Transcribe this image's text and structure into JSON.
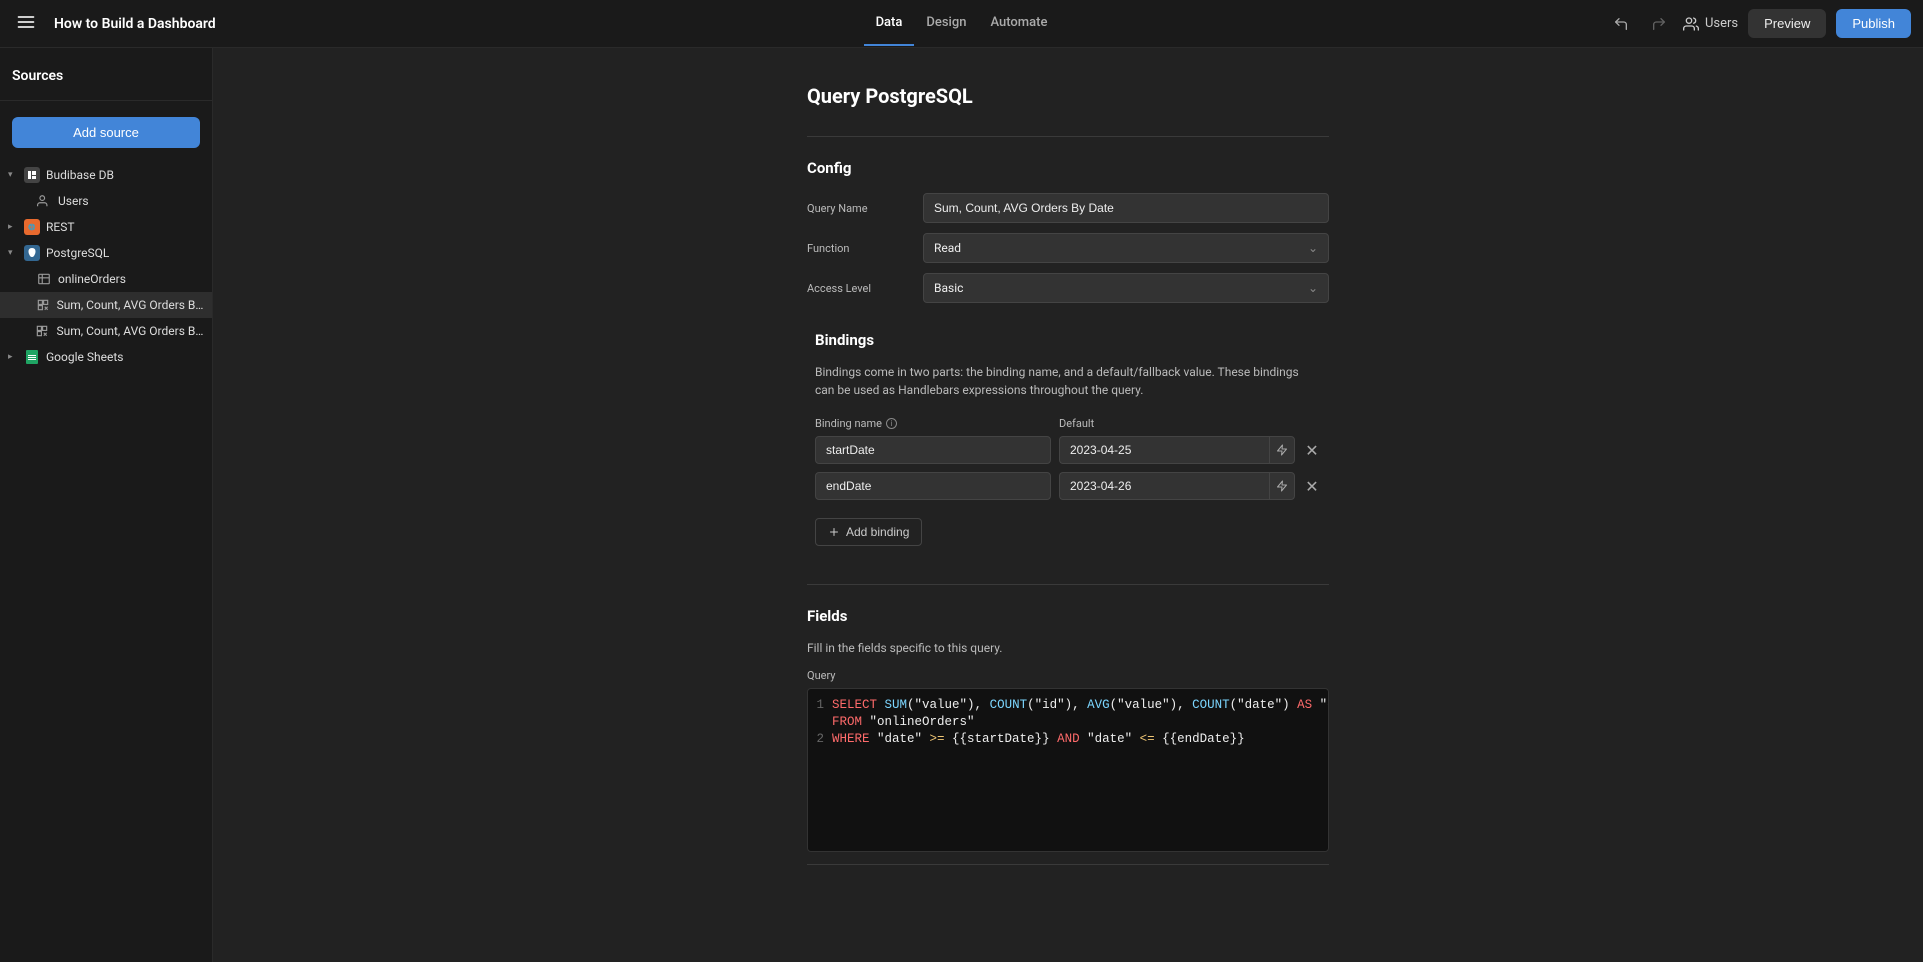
{
  "header": {
    "app_title": "How to Build a Dashboard",
    "tabs": [
      {
        "label": "Data",
        "active": true
      },
      {
        "label": "Design",
        "active": false
      },
      {
        "label": "Automate",
        "active": false
      }
    ],
    "users_label": "Users",
    "preview_label": "Preview",
    "publish_label": "Publish"
  },
  "sidebar": {
    "title": "Sources",
    "add_source_label": "Add source",
    "tree": {
      "budibase": {
        "label": "Budibase DB",
        "users_label": "Users"
      },
      "rest": {
        "label": "REST"
      },
      "postgresql": {
        "label": "PostgreSQL",
        "children": {
          "onlineOrders": "onlineOrders",
          "sumCountAvg1": "Sum, Count, AVG Orders By Date",
          "sumCountAvg2": "Sum, Count, AVG Orders By Dat…"
        }
      },
      "gsheets": {
        "label": "Google Sheets"
      }
    }
  },
  "main": {
    "title": "Query PostgreSQL",
    "config": {
      "heading": "Config",
      "query_name_label": "Query Name",
      "query_name_value": "Sum, Count, AVG Orders By Date",
      "function_label": "Function",
      "function_value": "Read",
      "access_level_label": "Access Level",
      "access_level_value": "Basic"
    },
    "bindings": {
      "heading": "Bindings",
      "description": "Bindings come in two parts: the binding name, and a default/fallback value. These bindings can be used as Handlebars expressions throughout the query.",
      "col_name_label": "Binding name",
      "col_default_label": "Default",
      "rows": [
        {
          "name": "startDate",
          "default": "2023-04-25"
        },
        {
          "name": "endDate",
          "default": "2023-04-26"
        }
      ],
      "add_label": "Add binding"
    },
    "fields": {
      "heading": "Fields",
      "description": "Fill in the fields specific to this query.",
      "query_label": "Query",
      "sql": {
        "line1_select": "SELECT",
        "line1_sum": "SUM",
        "line1_sum_arg": "(\"value\"), ",
        "line1_count1": "COUNT",
        "line1_count1_arg": "(\"id\"), ",
        "line1_avg": "AVG",
        "line1_avg_arg": "(\"value\"), ",
        "line1_count2": "COUNT",
        "line1_count2_arg": "(\"date\") ",
        "line1_as": "AS",
        "line1_days": " \"days\"",
        "line1b_from": "FROM",
        "line1b_table": " \"onlineOrders\"",
        "line2_where": "WHERE",
        "line2_rest_a": " \"date\" ",
        "line2_op1": ">=",
        "line2_b1": " {{startDate}} ",
        "line2_and": "AND",
        "line2_rest_b": " \"date\" ",
        "line2_op2": "<=",
        "line2_b2": " {{endDate}}"
      }
    }
  },
  "colors": {
    "accent": "#4285d8"
  }
}
